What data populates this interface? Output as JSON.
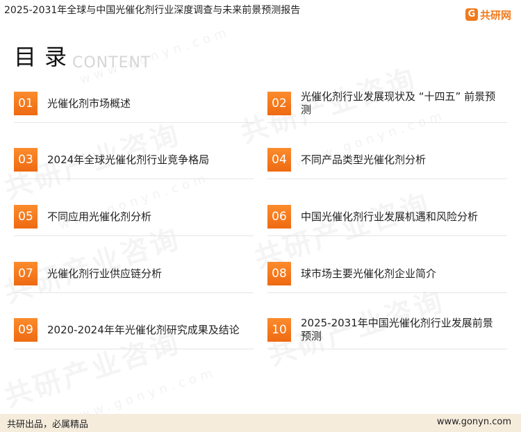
{
  "header": {
    "title": "2025-2031年全球与中国光催化剂行业深度调查与未来前景预测报告",
    "logo_mark": "G",
    "logo_text": "共研网"
  },
  "hero": {
    "title": "目录",
    "subtitle": "CONTENT"
  },
  "watermark": {
    "text": "共研产业咨询",
    "url": "www.gonyn.com"
  },
  "toc": [
    {
      "num": "01",
      "label": "光催化剂市场概述"
    },
    {
      "num": "02",
      "label": "光催化剂行业发展现状及 “十四五” 前景预测"
    },
    {
      "num": "03",
      "label": "2024年全球光催化剂行业竞争格局"
    },
    {
      "num": "04",
      "label": "不同产品类型光催化剂分析"
    },
    {
      "num": "05",
      "label": "不同应用光催化剂分析"
    },
    {
      "num": "06",
      "label": "中国光催化剂行业发展机遇和风险分析"
    },
    {
      "num": "07",
      "label": "光催化剂行业供应链分析"
    },
    {
      "num": "08",
      "label": "球市场主要光催化剂企业简介"
    },
    {
      "num": "09",
      "label": "2020-2024年年光催化剂研究成果及结论"
    },
    {
      "num": "10",
      "label": "2025-2031年中国光催化剂行业发展前景预测"
    }
  ],
  "footer": {
    "left": "共研出品，必属精品",
    "right": "www.gonyn.com"
  },
  "colors": {
    "accent": "#f07a1c",
    "footer_bg": "#f6ecdc"
  }
}
